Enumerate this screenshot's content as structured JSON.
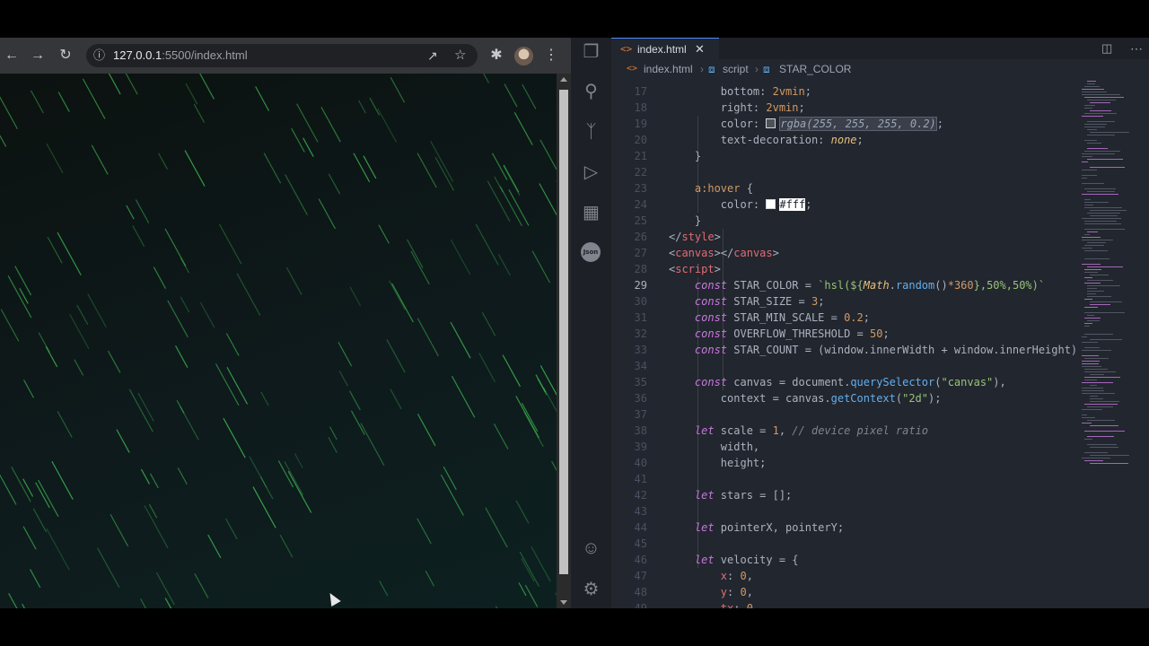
{
  "browser": {
    "url_host": "127.0.0.1",
    "url_path": ":5500/index.html",
    "icons": [
      "back-arrow-icon",
      "forward-arrow-icon",
      "reload-icon",
      "info-icon",
      "share-icon",
      "star-icon",
      "extensions-icon",
      "more-icon"
    ]
  },
  "editor_tab": {
    "label": "index.html",
    "close": "✕"
  },
  "breadcrumb": {
    "file": "index.html",
    "script": "script",
    "symbol": "STAR_COLOR"
  },
  "code_lines": [
    {
      "n": "17",
      "parts": [
        [
          "prop",
          "        bottom: "
        ],
        [
          "num",
          "2vmin"
        ],
        [
          "prop",
          ";"
        ]
      ]
    },
    {
      "n": "18",
      "parts": [
        [
          "prop",
          "        right: "
        ],
        [
          "num",
          "2vmin"
        ],
        [
          "prop",
          ";"
        ]
      ]
    },
    {
      "n": "19",
      "parts": [
        [
          "prop",
          "        color: "
        ],
        [
          "swatch",
          ""
        ],
        [
          "hl",
          "rgba(255, 255, 255, 0.2)"
        ],
        [
          "prop",
          ";"
        ]
      ]
    },
    {
      "n": "20",
      "parts": [
        [
          "prop",
          "        text-decoration: "
        ],
        [
          "it",
          "none"
        ],
        [
          "prop",
          ";"
        ]
      ]
    },
    {
      "n": "21",
      "parts": [
        [
          "prop",
          "    }"
        ]
      ]
    },
    {
      "n": "22",
      "parts": []
    },
    {
      "n": "23",
      "parts": [
        [
          "sel",
          "    a:hover"
        ],
        [
          "prop",
          " {"
        ]
      ]
    },
    {
      "n": "24",
      "parts": [
        [
          "prop",
          "        color: "
        ],
        [
          "swatch",
          ""
        ],
        [
          "hlw",
          "#fff"
        ],
        [
          "prop",
          ";"
        ]
      ]
    },
    {
      "n": "25",
      "parts": [
        [
          "prop",
          "    }"
        ]
      ]
    },
    {
      "n": "26",
      "parts": [
        [
          "prop",
          "</"
        ],
        [
          "tag",
          "style"
        ],
        [
          "prop",
          ">"
        ]
      ]
    },
    {
      "n": "27",
      "parts": [
        [
          "prop",
          "<"
        ],
        [
          "tag",
          "canvas"
        ],
        [
          "prop",
          "></"
        ],
        [
          "tag",
          "canvas"
        ],
        [
          "prop",
          ">"
        ]
      ]
    },
    {
      "n": "28",
      "parts": [
        [
          "prop",
          "<"
        ],
        [
          "tag",
          "script"
        ],
        [
          "prop",
          ">"
        ]
      ]
    },
    {
      "n": "29",
      "parts": [
        [
          "kw",
          "    const"
        ],
        [
          "prop",
          " STAR_COLOR = "
        ],
        [
          "str",
          "`hsl(${"
        ],
        [
          "it",
          "Math"
        ],
        [
          "prop",
          "."
        ],
        [
          "fn",
          "random"
        ],
        [
          "prop",
          "()"
        ],
        [
          "num",
          "*360"
        ],
        [
          "str",
          "},50%,50%)`"
        ]
      ]
    },
    {
      "n": "30",
      "parts": [
        [
          "kw",
          "    const"
        ],
        [
          "prop",
          " STAR_SIZE = "
        ],
        [
          "num",
          "3"
        ],
        [
          "prop",
          ";"
        ]
      ]
    },
    {
      "n": "31",
      "parts": [
        [
          "kw",
          "    const"
        ],
        [
          "prop",
          " STAR_MIN_SCALE = "
        ],
        [
          "num",
          "0.2"
        ],
        [
          "prop",
          ";"
        ]
      ]
    },
    {
      "n": "32",
      "parts": [
        [
          "kw",
          "    const"
        ],
        [
          "prop",
          " OVERFLOW_THRESHOLD = "
        ],
        [
          "num",
          "50"
        ],
        [
          "prop",
          ";"
        ]
      ]
    },
    {
      "n": "33",
      "parts": [
        [
          "kw",
          "    const"
        ],
        [
          "prop",
          " STAR_COUNT = (window.innerWidth + window.innerHeight)"
        ]
      ]
    },
    {
      "n": "34",
      "parts": []
    },
    {
      "n": "35",
      "parts": [
        [
          "kw",
          "    const"
        ],
        [
          "prop",
          " canvas = document."
        ],
        [
          "fn",
          "querySelector"
        ],
        [
          "prop",
          "("
        ],
        [
          "str",
          "\"canvas\""
        ],
        [
          "prop",
          "),"
        ]
      ]
    },
    {
      "n": "36",
      "parts": [
        [
          "prop",
          "        context = canvas."
        ],
        [
          "fn",
          "getContext"
        ],
        [
          "prop",
          "("
        ],
        [
          "str",
          "\"2d\""
        ],
        [
          "prop",
          ");"
        ]
      ]
    },
    {
      "n": "37",
      "parts": []
    },
    {
      "n": "38",
      "parts": [
        [
          "kw",
          "    let"
        ],
        [
          "prop",
          " scale = "
        ],
        [
          "num",
          "1"
        ],
        [
          "prop",
          ", "
        ],
        [
          "cmt",
          "// device pixel ratio"
        ]
      ]
    },
    {
      "n": "39",
      "parts": [
        [
          "prop",
          "        width,"
        ]
      ]
    },
    {
      "n": "40",
      "parts": [
        [
          "prop",
          "        height;"
        ]
      ]
    },
    {
      "n": "41",
      "parts": []
    },
    {
      "n": "42",
      "parts": [
        [
          "kw",
          "    let"
        ],
        [
          "prop",
          " stars = [];"
        ]
      ]
    },
    {
      "n": "43",
      "parts": []
    },
    {
      "n": "44",
      "parts": [
        [
          "kw",
          "    let"
        ],
        [
          "prop",
          " pointerX, pointerY;"
        ]
      ]
    },
    {
      "n": "45",
      "parts": []
    },
    {
      "n": "46",
      "parts": [
        [
          "kw",
          "    let"
        ],
        [
          "prop",
          " velocity = {"
        ]
      ]
    },
    {
      "n": "47",
      "parts": [
        [
          "var",
          "        x"
        ],
        [
          "prop",
          ": "
        ],
        [
          "num",
          "0"
        ],
        [
          "prop",
          ","
        ]
      ]
    },
    {
      "n": "48",
      "parts": [
        [
          "var",
          "        y"
        ],
        [
          "prop",
          ": "
        ],
        [
          "num",
          "0"
        ],
        [
          "prop",
          ","
        ]
      ]
    },
    {
      "n": "49",
      "parts": [
        [
          "var",
          "        tx"
        ],
        [
          "prop",
          ": "
        ],
        [
          "num",
          "0"
        ],
        [
          "prop",
          ","
        ]
      ]
    }
  ],
  "active_line": "29",
  "colors": {
    "accent": "#528bff",
    "star_green": "#3fb950",
    "editor_bg": "#22262e"
  }
}
